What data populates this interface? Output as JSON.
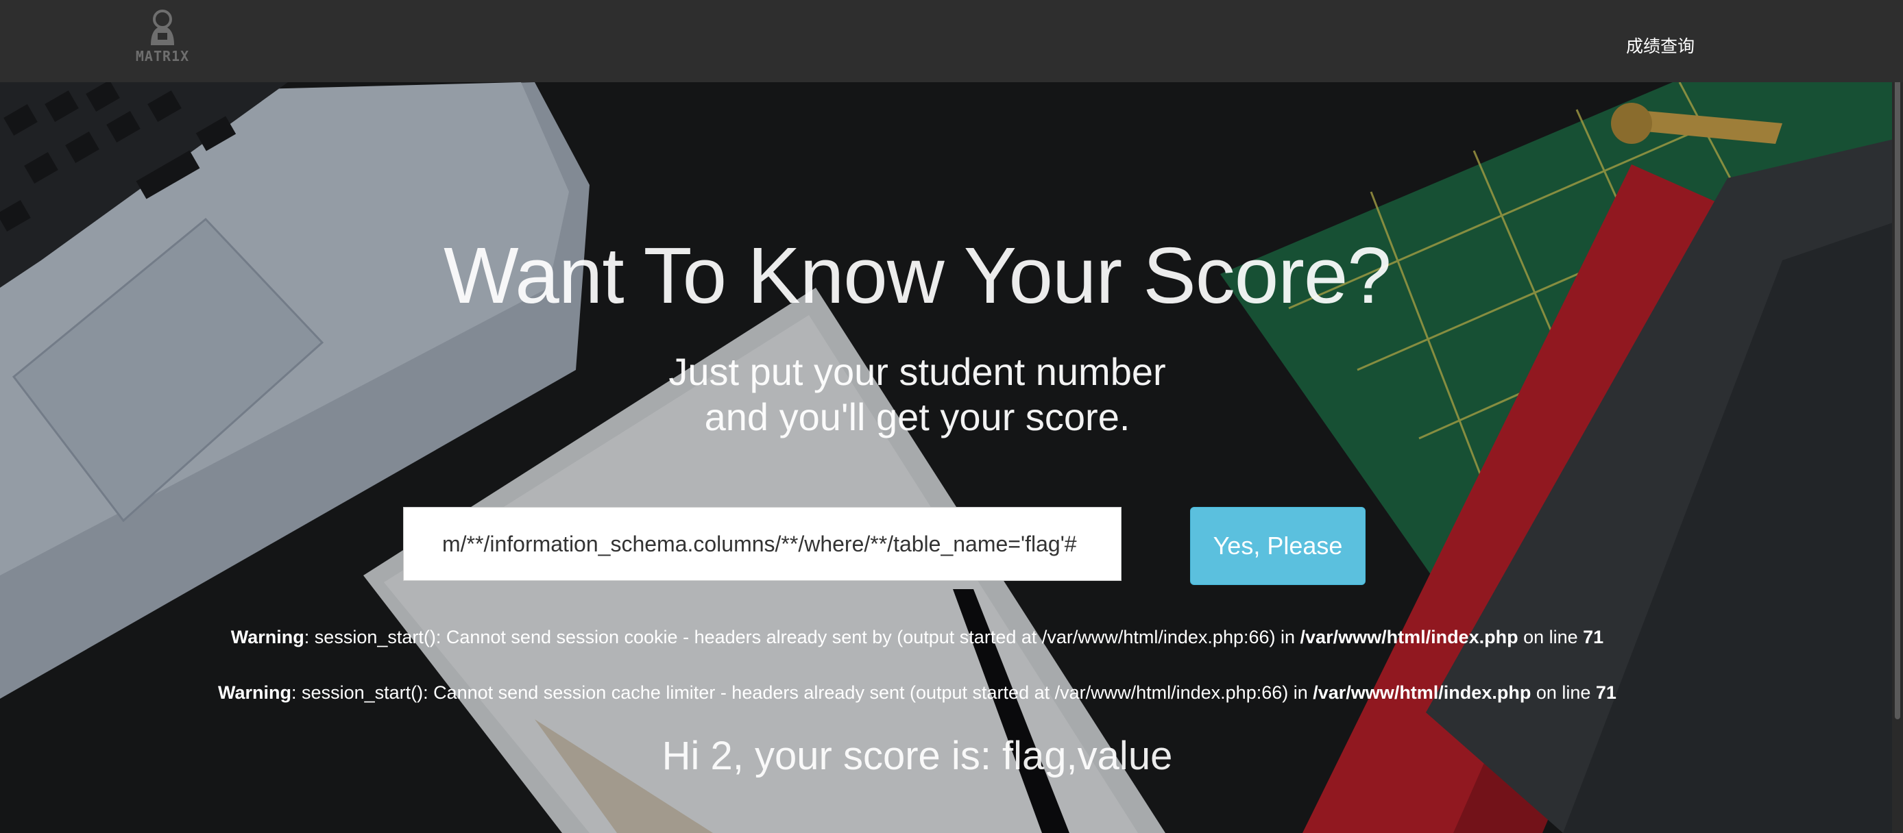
{
  "navbar": {
    "logo_text": "MATR1X",
    "link_label": "成绩查询"
  },
  "hero": {
    "title": "Want To Know Your Score?",
    "subtitle_line1": "Just put your student number",
    "subtitle_line2": "and you'll get your score."
  },
  "form": {
    "input_value": "m/**/information_schema.columns/**/where/**/table_name='flag'#",
    "submit_label": "Yes, Please"
  },
  "warnings": [
    {
      "label": "Warning",
      "message": ": session_start(): Cannot send session cookie - headers already sent by (output started at /var/www/html/index.php:66) in ",
      "file": "/var/www/html/index.php",
      "line_text": " on line ",
      "line": "71"
    },
    {
      "label": "Warning",
      "message": ": session_start(): Cannot send session cache limiter - headers already sent (output started at /var/www/html/index.php:66) in ",
      "file": "/var/www/html/index.php",
      "line_text": " on line ",
      "line": "71"
    }
  ],
  "result": {
    "text": "Hi 2, your score is: flag,value"
  },
  "colors": {
    "navbar": "#2e2e2e",
    "button": "#5bc0de"
  }
}
